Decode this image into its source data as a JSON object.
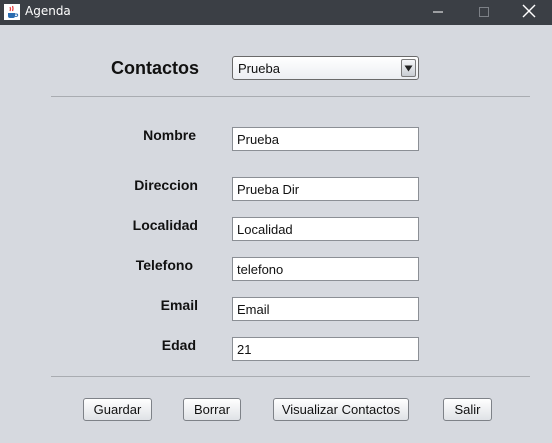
{
  "window": {
    "title": "Agenda",
    "icons": {
      "app": "java-cup-icon",
      "minimize": "minimize-icon",
      "maximize": "maximize-icon",
      "close": "close-icon"
    }
  },
  "header": {
    "label": "Contactos",
    "selected_contact": "Prueba",
    "dropdown_icon": "chevron-down-icon"
  },
  "form": {
    "nombre": {
      "label": "Nombre",
      "value": "Prueba"
    },
    "direccion": {
      "label": "Direccion",
      "value": "Prueba Dir"
    },
    "localidad": {
      "label": "Localidad",
      "value": "Localidad"
    },
    "telefono": {
      "label": "Telefono",
      "value": "telefono"
    },
    "email": {
      "label": "Email",
      "value": "Email"
    },
    "edad": {
      "label": "Edad",
      "value": "21"
    }
  },
  "buttons": {
    "guardar": "Guardar",
    "borrar": "Borrar",
    "visualizar": "Visualizar Contactos",
    "salir": "Salir"
  },
  "colors": {
    "titlebar": "#3b3f45",
    "background": "#d6d9df"
  }
}
